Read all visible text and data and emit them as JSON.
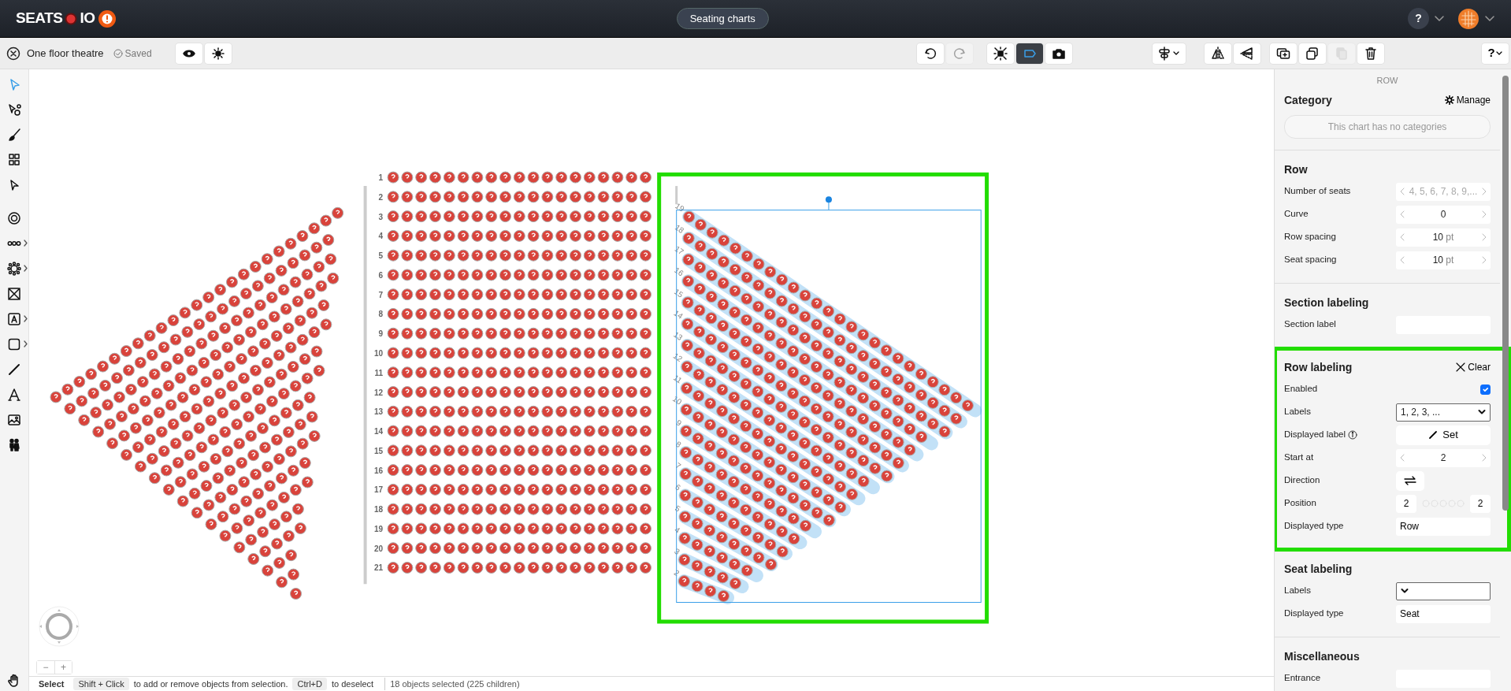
{
  "header": {
    "logo": [
      "SEATS",
      "IO"
    ],
    "nav_button": "Seating charts",
    "help_button": "?"
  },
  "toolbar": {
    "chart_name": "One floor theatre",
    "status": "Saved",
    "groups": [
      {
        "buttons": [
          {
            "kind": "preview",
            "active": false,
            "disabled": false
          },
          {
            "kind": "theme",
            "active": false,
            "disabled": false
          }
        ]
      },
      {
        "buttons": [
          {
            "kind": "undo",
            "active": false,
            "disabled": false
          },
          {
            "kind": "redo",
            "active": false,
            "disabled": true
          }
        ]
      },
      {
        "buttons": [
          {
            "kind": "focus",
            "active": false,
            "disabled": false
          },
          {
            "kind": "label",
            "active": true,
            "disabled": false
          },
          {
            "kind": "camera",
            "active": false,
            "disabled": false
          }
        ]
      },
      {
        "buttons": [
          {
            "kind": "align",
            "active": false,
            "disabled": false
          }
        ]
      },
      {
        "buttons": [
          {
            "kind": "flip-h",
            "active": false,
            "disabled": false
          },
          {
            "kind": "flip-v",
            "active": false,
            "disabled": false
          }
        ]
      },
      {
        "buttons": [
          {
            "kind": "add-copy",
            "active": false,
            "disabled": false
          },
          {
            "kind": "duplicate",
            "active": false,
            "disabled": false
          },
          {
            "kind": "paste",
            "active": false,
            "disabled": true
          },
          {
            "kind": "delete",
            "active": false,
            "disabled": false
          }
        ]
      }
    ],
    "help_button": "?"
  },
  "tools": [
    {
      "kind": "select",
      "selected": true,
      "submenu": false
    },
    {
      "kind": "node",
      "selected": false,
      "submenu": false
    },
    {
      "kind": "brush",
      "selected": false,
      "submenu": false
    },
    {
      "kind": "seats",
      "selected": false,
      "submenu": false
    },
    {
      "kind": "pointer",
      "selected": false,
      "submenu": false
    },
    {
      "kind": "target",
      "selected": false,
      "submenu": false
    },
    {
      "kind": "row",
      "selected": false,
      "submenu": true
    },
    {
      "kind": "table",
      "selected": false,
      "submenu": true
    },
    {
      "kind": "cross",
      "selected": false,
      "submenu": false
    },
    {
      "kind": "label",
      "selected": false,
      "submenu": true
    },
    {
      "kind": "shape",
      "selected": false,
      "submenu": true
    },
    {
      "kind": "line",
      "selected": false,
      "submenu": false
    },
    {
      "kind": "text",
      "selected": false,
      "submenu": false
    },
    {
      "kind": "image",
      "selected": false,
      "submenu": false
    },
    {
      "kind": "people",
      "selected": false,
      "submenu": false
    },
    {
      "kind": "hand",
      "selected": false,
      "submenu": false
    }
  ],
  "canvas": {
    "sections": [
      {
        "kind": "wedge",
        "selected": false,
        "highlighted": false
      },
      {
        "kind": "grid",
        "selected": false,
        "highlighted": false,
        "row_labels": [
          "1",
          "2",
          "3",
          "4",
          "5",
          "6",
          "7",
          "8",
          "9",
          "10",
          "11",
          "12",
          "13",
          "14",
          "15",
          "16",
          "17",
          "18",
          "19",
          "20",
          "21"
        ]
      },
      {
        "kind": "slant",
        "selected": true,
        "highlighted": true,
        "row_labels": [
          "19",
          "18",
          "17",
          "16",
          "15",
          "14",
          "13",
          "12",
          "11",
          "10",
          "9",
          "8",
          "7",
          "6",
          "5",
          "4",
          "3",
          "2"
        ]
      }
    ],
    "zoom": [
      "−",
      "+"
    ]
  },
  "status_bar": {
    "mode": "Select",
    "hints": [
      {
        "kind": "key",
        "text": "Shift + Click"
      },
      {
        "kind": "text",
        "text": "to add or remove objects from selection."
      },
      {
        "kind": "key",
        "text": "Ctrl+D"
      },
      {
        "kind": "text",
        "text": "to deselect"
      }
    ],
    "selection": "18 objects selected (225 children)"
  },
  "panel": {
    "object_type": "ROW",
    "sections": [
      {
        "title": "Category",
        "highlighted": false,
        "action": {
          "kind": "manage",
          "label": "Manage"
        },
        "note": "This chart has no categories"
      },
      {
        "title": "Row",
        "highlighted": false,
        "fields": [
          {
            "label": "Number of seats",
            "kind": "stepper",
            "value": "4, 5, 6, 7, 8, 9,...",
            "disabled": true
          },
          {
            "label": "Curve",
            "kind": "stepper",
            "value": "0",
            "disabled": false
          },
          {
            "label": "Row spacing",
            "kind": "stepper",
            "value": "10",
            "unit": "pt",
            "disabled": false
          },
          {
            "label": "Seat spacing",
            "kind": "stepper",
            "value": "10",
            "unit": "pt",
            "disabled": false
          }
        ]
      },
      {
        "title": "Section labeling",
        "highlighted": false,
        "fields": [
          {
            "label": "Section label",
            "kind": "text"
          }
        ]
      },
      {
        "title": "Row labeling",
        "highlighted": true,
        "action": {
          "kind": "clear",
          "label": "Clear"
        },
        "fields": [
          {
            "label": "Enabled",
            "kind": "checkbox",
            "checked": true
          },
          {
            "label": "Labels",
            "kind": "select",
            "value": "1, 2, 3, ..."
          },
          {
            "label": "Displayed label",
            "kind": "button",
            "info": true,
            "value": "Set"
          },
          {
            "label": "Start at",
            "kind": "stepper",
            "value": "2",
            "disabled": false
          },
          {
            "label": "Direction",
            "kind": "swap"
          },
          {
            "label": "Position",
            "kind": "position",
            "values": [
              "2",
              "2"
            ]
          },
          {
            "label": "Displayed type",
            "kind": "text",
            "value": "Row"
          }
        ]
      },
      {
        "title": "Seat labeling",
        "highlighted": false,
        "fields": [
          {
            "label": "Labels",
            "kind": "select"
          },
          {
            "label": "Displayed type",
            "kind": "text",
            "value": "Seat"
          }
        ]
      },
      {
        "title": "Miscellaneous",
        "highlighted": false,
        "fields": [
          {
            "label": "Entrance",
            "kind": "text"
          }
        ]
      }
    ]
  }
}
